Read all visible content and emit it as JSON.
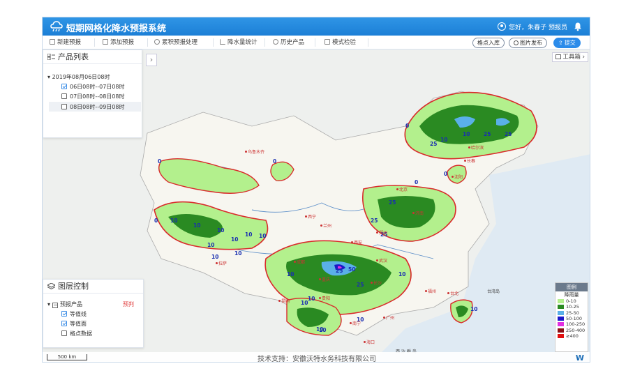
{
  "app": {
    "title": "短期网格化降水预报系统",
    "user_greeting": "您好，朱春子 预报员"
  },
  "toolbar": {
    "new_forecast": "新建预报",
    "add_forecast": "添加预报",
    "accumulate": "累积预报处理",
    "precip_stats": "降水量统计",
    "history": "历史产品",
    "model_check": "模式检验",
    "grid_import": "格点入库",
    "image_publish": "图片发布",
    "submit": "提交"
  },
  "product_panel": {
    "title": "产品列表",
    "date_node": "2019年08月06日08时",
    "items": [
      {
        "label": "06日08时--07日08时",
        "checked": true
      },
      {
        "label": "07日08时--08日08时",
        "checked": false
      },
      {
        "label": "08日08时--09日08时",
        "checked": false
      }
    ]
  },
  "layer_panel": {
    "title": "图层控制",
    "root": "预报产品",
    "root_tag": "预判",
    "items": [
      {
        "label": "等值线",
        "checked": true
      },
      {
        "label": "等值面",
        "checked": true
      },
      {
        "label": "格点数据",
        "checked": false
      }
    ]
  },
  "toolbox": {
    "label": "工具箱"
  },
  "legend": {
    "title": "图例",
    "subtitle": "降雨量",
    "unit": "毫米",
    "items": [
      {
        "label": "0-10",
        "color": "#b3f08d"
      },
      {
        "label": "10-25",
        "color": "#2a8a22"
      },
      {
        "label": "25-50",
        "color": "#5ab0e8"
      },
      {
        "label": "50-100",
        "color": "#1c18c8"
      },
      {
        "label": "100-250",
        "color": "#e22fe0"
      },
      {
        "label": "250-400",
        "color": "#8a0f14"
      },
      {
        "label": "≥400",
        "color": "#e01010"
      }
    ]
  },
  "map": {
    "scale_label": "500 km",
    "credit": "技术支持：安徽沃特水务科技有限公司",
    "brand_mark": "W",
    "contour_labels": [
      "0",
      "10",
      "25",
      "10",
      "25",
      "25",
      "0",
      "0",
      "0",
      "10",
      "10",
      "10",
      "10",
      "10",
      "10",
      "10",
      "10",
      "10",
      "25",
      "25",
      "50",
      "25",
      "25",
      "10",
      "10",
      "10",
      "10",
      "10",
      "25",
      "0",
      "0",
      "10",
      "10",
      "10"
    ],
    "cities": [
      "乌鲁木齐",
      "哈尔滨",
      "长春",
      "沈阳",
      "北京",
      "济南",
      "西宁",
      "兰州",
      "西安",
      "郑州",
      "拉萨",
      "成都",
      "重庆",
      "武汉",
      "贵阳",
      "长沙",
      "南宁",
      "广州",
      "海口",
      "台北",
      "福州",
      "昆明"
    ],
    "sea_labels": [
      "台湾岛",
      "西 沙 群 岛"
    ]
  }
}
